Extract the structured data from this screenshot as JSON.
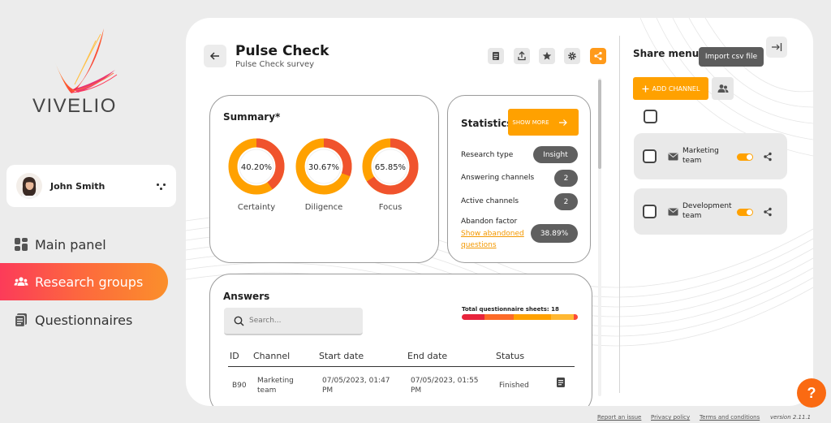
{
  "brand": {
    "name": "VIVELIO"
  },
  "user": {
    "name": "John Smith"
  },
  "nav": [
    {
      "label": "Main panel",
      "icon": "dashboard-icon"
    },
    {
      "label": "Research groups",
      "icon": "people-icon",
      "active": true
    },
    {
      "label": "Questionnaires",
      "icon": "document-icon"
    }
  ],
  "page": {
    "title": "Pulse Check",
    "subtitle": "Pulse Check survey"
  },
  "toolbar": {
    "icons": [
      "list-icon",
      "upload-icon",
      "star-icon",
      "gear-icon",
      "share-icon"
    ]
  },
  "summary": {
    "title": "Summary*",
    "metrics": [
      {
        "label": "Certainty",
        "value": "40.20%",
        "fraction": 0.402
      },
      {
        "label": "Diligence",
        "value": "30.67%",
        "fraction": 0.3067
      },
      {
        "label": "Focus",
        "value": "65.85%",
        "fraction": 0.6585
      }
    ]
  },
  "statistics": {
    "title": "Statistics",
    "show_more": "SHOW MORE",
    "research_type_label": "Research type",
    "research_type_value": "Insight",
    "answering_channels_label": "Answering channels",
    "answering_channels_value": "2",
    "active_channels_label": "Active channels",
    "active_channels_value": "2",
    "abandon_factor_label": "Abandon factor",
    "abandon_factor_value": "38.89%",
    "show_abandoned_link": "Show abandoned questions"
  },
  "answers": {
    "title": "Answers",
    "search_placeholder": "Search...",
    "total_sheets_label": "Total questionnaire sheets: 18",
    "columns": [
      "ID",
      "Channel",
      "Start date",
      "End date",
      "Status"
    ],
    "rows": [
      {
        "id": "B90",
        "channel": "Marketing team",
        "start": "07/05/2023, 01:47 PM",
        "end": "07/05/2023, 01:55 PM",
        "status": "Finished"
      }
    ]
  },
  "share_menu": {
    "title": "Share menu",
    "import_tooltip": "Import csv file",
    "add_channel": "ADD CHANNEL",
    "channels": [
      {
        "name": "Marketing team",
        "active": true
      },
      {
        "name": "Development team",
        "active": true
      }
    ]
  },
  "footer": {
    "report_issue": "Report an issue",
    "privacy_policy": "Privacy policy",
    "terms": "Terms and conditions",
    "version": "version 2.11.1",
    "help": "?"
  },
  "colors": {
    "accent": "#ffa100",
    "active_gradient": [
      "#fc3b59",
      "#fb8f2b"
    ],
    "donut_dark": "#f0532d",
    "donut_light": "#ffa100"
  }
}
